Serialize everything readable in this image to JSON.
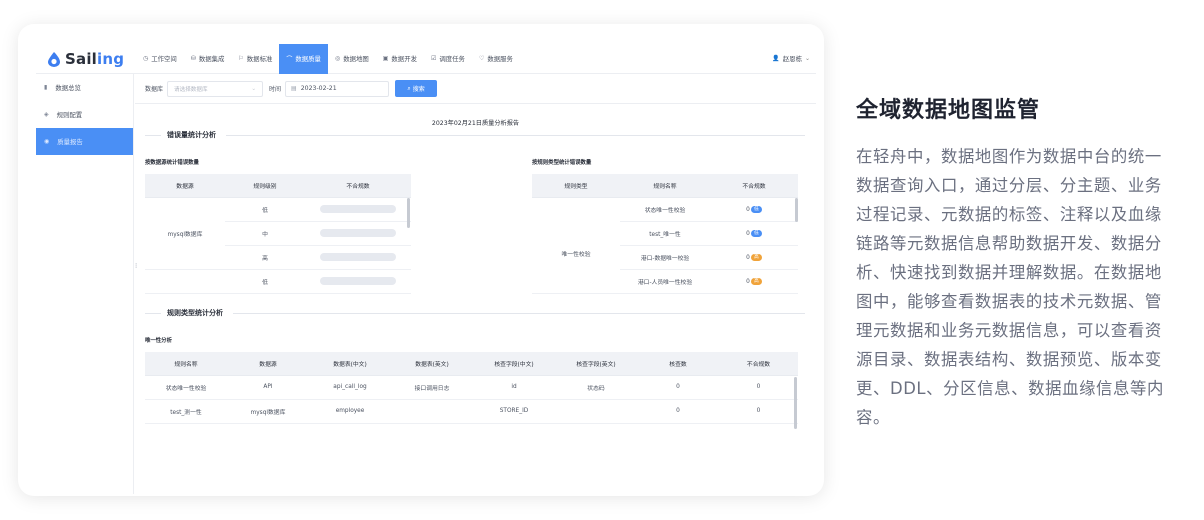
{
  "app": {
    "logo": {
      "prefix": "Sail",
      "suffix": "ing"
    },
    "nav": [
      {
        "label": "工作空间",
        "icon": "◷"
      },
      {
        "label": "数据集成",
        "icon": "⛁"
      },
      {
        "label": "数据标准",
        "icon": "⚐"
      },
      {
        "label": "数据质量",
        "icon": "⌒"
      },
      {
        "label": "数据地图",
        "icon": "◎"
      },
      {
        "label": "数据开发",
        "icon": "▣"
      },
      {
        "label": "调度任务",
        "icon": "☑"
      },
      {
        "label": "数据服务",
        "icon": "♡"
      }
    ],
    "active_nav_index": 3,
    "user": {
      "name": "赵恩栋",
      "icon": "👤",
      "chevron": "⌄"
    },
    "sidebar": [
      {
        "label": "数据总览",
        "icon": "▮"
      },
      {
        "label": "规则配置",
        "icon": "◈"
      },
      {
        "label": "质量报告",
        "icon": "◉"
      }
    ],
    "active_sidebar_index": 2,
    "filter": {
      "db_label": "数据库",
      "db_placeholder": "请选择数据库",
      "time_label": "时间",
      "date_value": "2023-02-21",
      "search_label": "搜索",
      "search_icon": "⌕"
    },
    "report_title": "2023年02月21日质量分析报告",
    "error_section": {
      "title": "错误量统计分析",
      "left": {
        "subtitle": "按数据源统计错误数量",
        "headers": [
          "数据源",
          "规则级别",
          "不合规数"
        ],
        "source": "mysql数据库",
        "levels": [
          "低",
          "中",
          "高",
          "低"
        ]
      },
      "right": {
        "subtitle": "按规则类型统计错误数量",
        "headers": [
          "规则类型",
          "规则名称",
          "不合规数"
        ],
        "type": "唯一性校验",
        "rows": [
          {
            "name": "状态唯一性校验",
            "count": "0",
            "tag": "低",
            "color": "#4a8ff5"
          },
          {
            "name": "test_唯一性",
            "count": "0",
            "tag": "低",
            "color": "#4a8ff5"
          },
          {
            "name": "港口-数据唯一校验",
            "count": "0",
            "tag": "高",
            "color": "#f0a33a"
          },
          {
            "name": "港口-人员唯一性校验",
            "count": "0",
            "tag": "高",
            "color": "#f0a33a"
          }
        ]
      }
    },
    "rule_section": {
      "title": "规则类型统计分析",
      "subtitle": "唯一性分析",
      "headers": [
        "规则名称",
        "数据源",
        "数据表(中文)",
        "数据表(英文)",
        "核查字段(中文)",
        "核查字段(英文)",
        "核查数",
        "不合规数"
      ],
      "rows": [
        [
          "状态唯一性校验",
          "API",
          "api_call_log",
          "接口调用日志",
          "id",
          "状态码",
          "0",
          "0"
        ],
        [
          "test_测一性",
          "mysql数据库",
          "employee",
          "",
          "STORE_ID",
          "",
          "0",
          "0"
        ]
      ]
    }
  },
  "side_panel": {
    "heading": "全域数据地图监管",
    "body": "在轻舟中，数据地图作为数据中台的统一数据查询入口，通过分层、分主题、业务过程记录、元数据的标签、注释以及血缘链路等元数据信息帮助数据开发、数据分析、快速找到数据并理解数据。在数据地图中，能够查看数据表的技术元数据、管理元数据和业务元数据信息，可以查看资源目录、数据表结构、数据预览、版本变更、DDL、分区信息、数据血缘信息等内容。"
  }
}
